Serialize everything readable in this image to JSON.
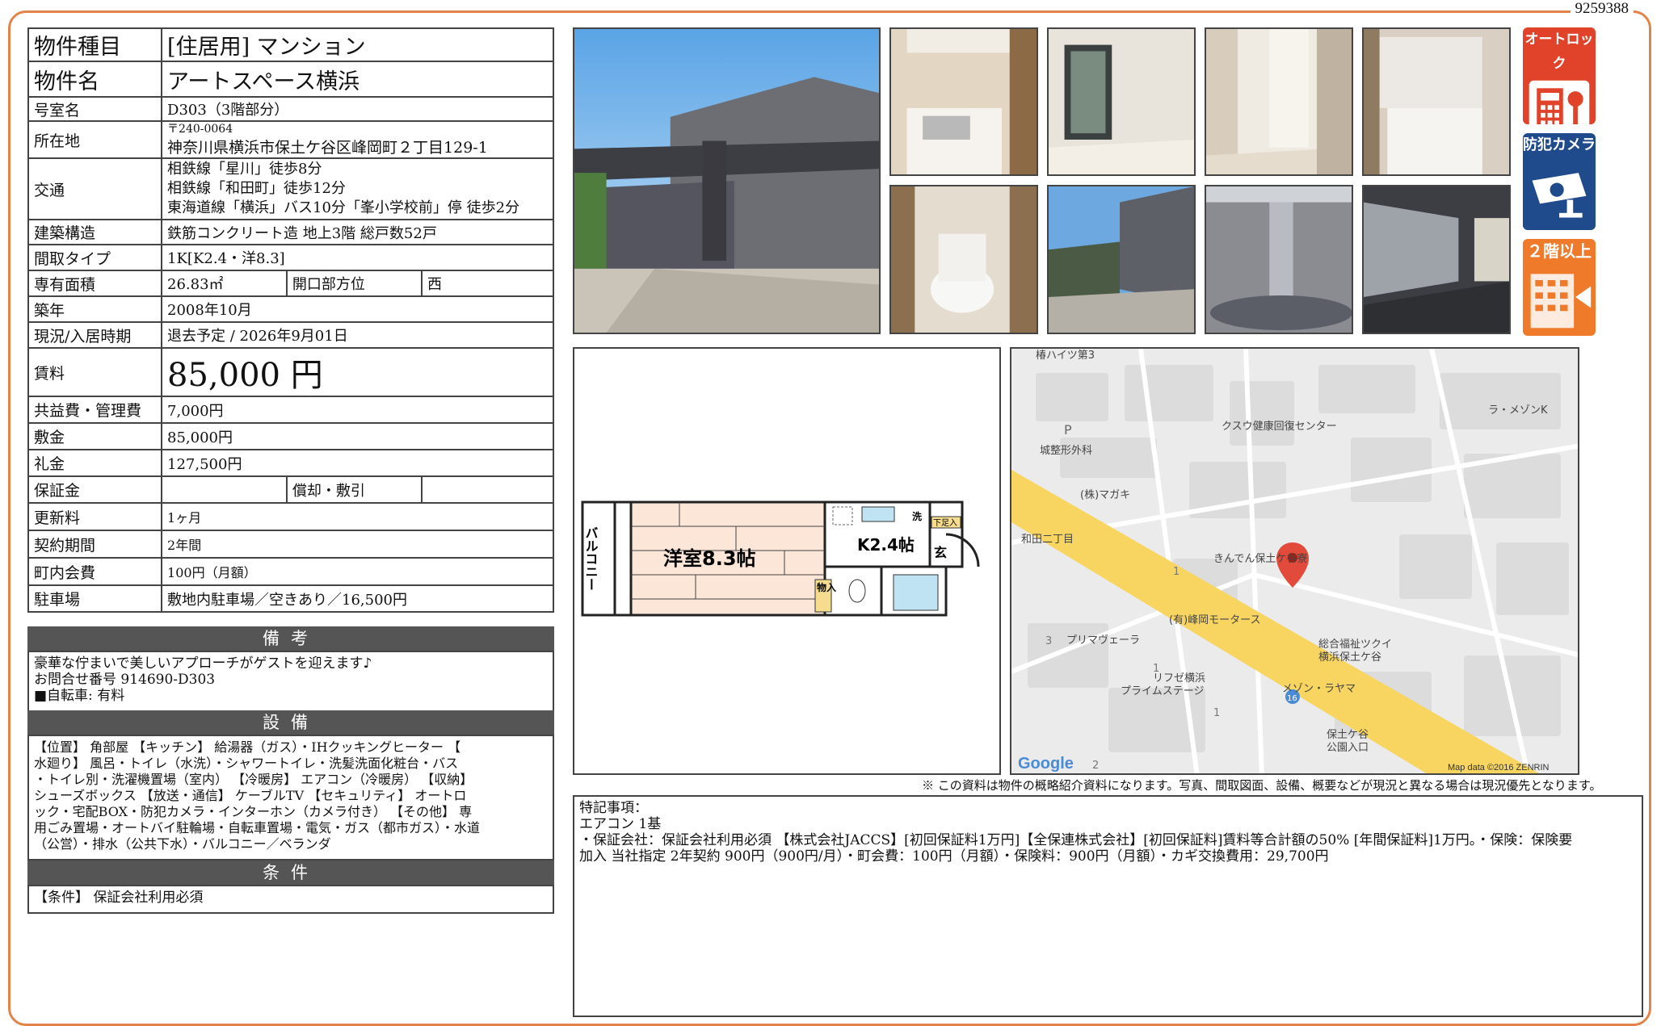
{
  "doc_id": "9259388",
  "info": {
    "type_label": "物件種目",
    "type_value": "[住居用] マンション",
    "name_label": "物件名",
    "name_value": "アートスペース横浜",
    "room_label": "号室名",
    "room_value": "D303（3階部分）",
    "addr_label": "所在地",
    "addr_zip": "〒240-0064",
    "addr_value": "神奈川県横浜市保土ケ谷区峰岡町２丁目129-1",
    "traffic_label": "交通",
    "traffic_1": "相鉄線「星川」徒歩8分",
    "traffic_2": "相鉄線「和田町」徒歩12分",
    "traffic_3": "東海道線「横浜」バス10分「峯小学校前」停 徒歩2分",
    "struct_label": "建築構造",
    "struct_value": "鉄筋コンクリート造 地上3階 総戸数52戸",
    "layout_label": "間取タイプ",
    "layout_value": "1K[K2.4・洋8.3]",
    "area_label": "専有面積",
    "area_value": "26.83㎡",
    "dir_label": "開口部方位",
    "dir_value": "西",
    "built_label": "築年",
    "built_value": "2008年10月",
    "status_label": "現況/入居時期",
    "status_value": "退去予定 /  2026年9月01日",
    "rent_label": "賃料",
    "rent_value": "85,000 円",
    "fee_label": "共益費・管理費",
    "fee_value": "7,000円",
    "deposit_label": "敷金",
    "deposit_value": "85,000円",
    "key_label": "礼金",
    "key_value": "127,500円",
    "guarantee_label": "保証金",
    "guarantee_value": "",
    "amort_label": "償却・敷引",
    "amort_value": "",
    "renew_label": "更新料",
    "renew_value": "1ヶ月",
    "term_label": "契約期間",
    "term_value": "2年間",
    "town_label": "町内会費",
    "town_value": "100円（月額）",
    "parking_label": "駐車場",
    "parking_value": "敷地内駐車場／空きあり／16,500円"
  },
  "remarks_section": {
    "title": "備考",
    "text": "豪華な佇まいで美しいアプローチがゲストを迎えます♪\nお問合せ番号 914690-D303\n■自転車: 有料"
  },
  "equipment_section": {
    "title": "設備",
    "text": "【位置】 角部屋 【キッチン】 給湯器（ガス）・IHクッキングヒーター 【\n水廻り】 風呂・トイレ（水洗）・シャワートイレ・洗髪洗面化粧台・バス\n・トイレ別・洗濯機置場（室内） 【冷暖房】 エアコン（冷暖房） 【収納】\nシューズボックス 【放送・通信】 ケーブルTV 【セキュリティ】 オートロ\nック・宅配BOX・防犯カメラ・インターホン（カメラ付き） 【その他】 専\n用ごみ置場・オートバイ駐輪場・自転車置場・電気・ガス（都市ガス）・水道\n（公営）・排水（公共下水）・バルコニー／ベランダ"
  },
  "conditions_section": {
    "title": "条件",
    "text": "【条件】 保証会社利用必須"
  },
  "badges": {
    "autolock": "オートロック",
    "camera": "防犯カメラ",
    "floor": "２階以上"
  },
  "floorplan": {
    "balcony": "バルコニー",
    "western": "洋室8.3帖",
    "kitchen": "K2.4帖",
    "entrance": "玄",
    "closet": "物入",
    "wash": "洗",
    "shoes": "下足入"
  },
  "map": {
    "labels": [
      "椿ハイツ第3",
      "クスウ健康回復センター",
      "ラ・メゾンK",
      "城整形外科",
      "(株)マガキ",
      "和田二丁目",
      "きんでん保土ケ谷寮",
      "(有)峰岡モータース",
      "プリマヴェーラ",
      "総合福祉ツクイ",
      "横浜保土ケ谷",
      "リフゼ横浜",
      "プライムステージ",
      "メゾン・ラヤマ",
      "保土ケ谷",
      "公園入口",
      "Google",
      "Map data ©2016 ZENRIN",
      "16",
      "P",
      "1",
      "1",
      "1",
      "2",
      "3"
    ]
  },
  "disclaimer": "※ この資料は物件の概略紹介資料になります。写真、間取図面、設備、概要などが現況と異なる場合は現況優先となります。",
  "special": {
    "text": "特記事項：\nエアコン 1基\n・保証会社：保証会社利用必須 【株式会社JACCS】[初回保証料1万円]【全保連株式会社】[初回保証料]賃料等合計額の50% [年間保証料]1万円。・保険：保険要\n加入 当社指定 2年契約 900円（900円/月）・町会費：100円（月額）・保険料：900円（月額）・カギ交換費用：29,700円"
  }
}
